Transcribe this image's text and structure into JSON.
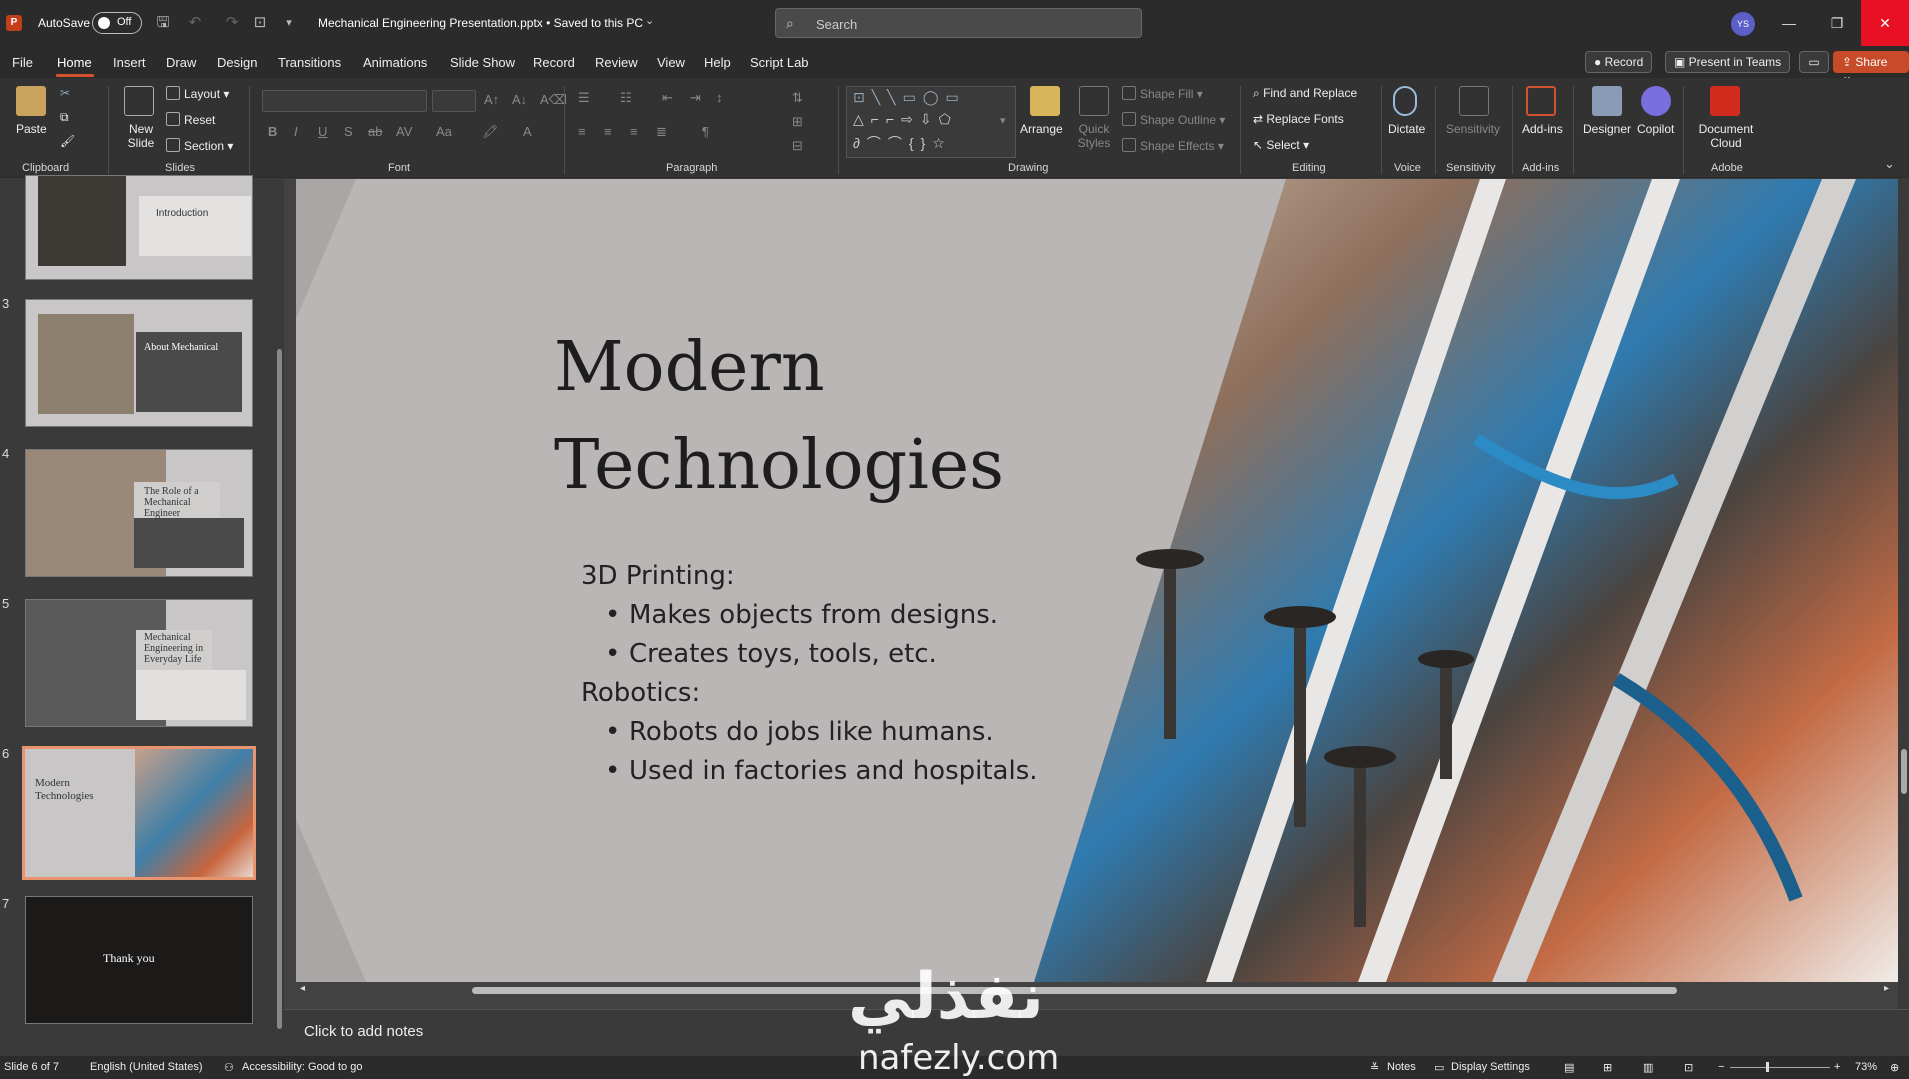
{
  "titlebar": {
    "autosave_label": "AutoSave",
    "autosave_state": "Off",
    "doc_title": "Mechanical Engineering Presentation.pptx • Saved to this PC",
    "search_placeholder": "Search",
    "avatar_initials": "YS"
  },
  "menu": {
    "tabs": [
      "File",
      "Home",
      "Insert",
      "Draw",
      "Design",
      "Transitions",
      "Animations",
      "Slide Show",
      "Record",
      "Review",
      "View",
      "Help",
      "Script Lab"
    ],
    "active": "Home",
    "record_label": "Record",
    "present_teams_label": "Present in Teams",
    "share_label": "Share"
  },
  "ribbon": {
    "clipboard": {
      "paste": "Paste",
      "group": "Clipboard"
    },
    "slides": {
      "new_slide": "New Slide",
      "layout": "Layout",
      "reset": "Reset",
      "section": "Section",
      "group": "Slides"
    },
    "font": {
      "group": "Font"
    },
    "paragraph": {
      "group": "Paragraph"
    },
    "drawing": {
      "arrange": "Arrange",
      "quick_styles": "Quick Styles",
      "shape_fill": "Shape Fill",
      "shape_outline": "Shape Outline",
      "shape_effects": "Shape Effects",
      "group": "Drawing"
    },
    "editing": {
      "find_replace": "Find and Replace",
      "replace_fonts": "Replace Fonts",
      "select": "Select",
      "group": "Editing"
    },
    "voice": {
      "dictate": "Dictate",
      "group": "Voice"
    },
    "sensitivity": {
      "label": "Sensitivity",
      "group": "Sensitivity"
    },
    "addins": {
      "label": "Add-ins",
      "group": "Add-ins"
    },
    "designer": "Designer",
    "copilot": "Copilot",
    "adobe": {
      "document_cloud_1": "Document",
      "document_cloud_2": "Cloud",
      "group": "Adobe"
    }
  },
  "thumbnails": [
    {
      "num": "",
      "title": "Introduction"
    },
    {
      "num": "3",
      "title": "About Mechanical"
    },
    {
      "num": "4",
      "title": "The Role of a Mechanical Engineer"
    },
    {
      "num": "5",
      "title": "Mechanical Engineering in Everyday Life"
    },
    {
      "num": "6",
      "title": "Modern Technologies"
    },
    {
      "num": "7",
      "title": "Thank you"
    }
  ],
  "slide": {
    "title_line1": "Modern",
    "title_line2": "Technologies",
    "heading1": "3D Printing:",
    "bullet1": "Makes objects from designs.",
    "bullet2": "Creates toys, tools, etc.",
    "heading2": "Robotics:",
    "bullet3": "Robots do jobs like humans.",
    "bullet4": "Used in factories and hospitals."
  },
  "notes_placeholder": "Click to add notes",
  "status": {
    "slide_counter": "Slide 6 of 7",
    "language": "English (United States)",
    "accessibility": "Accessibility: Good to go",
    "notes": "Notes",
    "display_settings": "Display Settings",
    "zoom": "73%"
  },
  "watermark": {
    "arabic": "نفذلي",
    "latin": "nafezly.com"
  },
  "colors": {
    "accent": "#d35230",
    "share": "#c84b29",
    "selected_thumb": "#e8956f",
    "close": "#e81123"
  }
}
